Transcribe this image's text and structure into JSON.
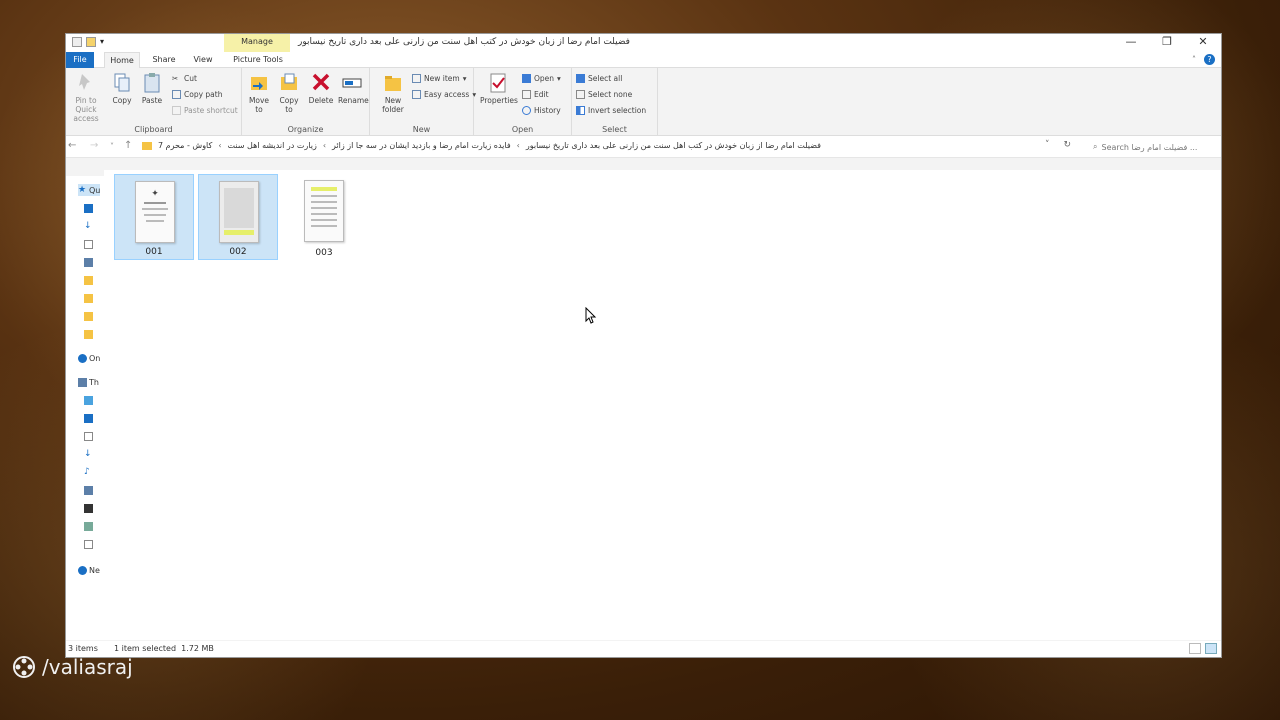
{
  "window": {
    "title": "فضیلت امام رضا از زبان خودش در کتب اهل سنت من زارنی علی بعد داری تاریخ نیسابور",
    "manage_tab": "Manage",
    "controls": {
      "minimize": "—",
      "maximize": "❐",
      "close": "✕"
    }
  },
  "tabs": {
    "file": "File",
    "home": "Home",
    "share": "Share",
    "view": "View",
    "picture_tools": "Picture Tools"
  },
  "ribbon": {
    "clipboard": {
      "label": "Clipboard",
      "pin": "Pin to Quick access",
      "copy": "Copy",
      "paste": "Paste",
      "cut": "Cut",
      "copy_path": "Copy path",
      "paste_shortcut": "Paste shortcut"
    },
    "organize": {
      "label": "Organize",
      "move_to": "Move to",
      "copy_to": "Copy to",
      "delete": "Delete",
      "rename": "Rename"
    },
    "new": {
      "label": "New",
      "new_folder": "New folder",
      "new_item": "New item",
      "easy_access": "Easy access"
    },
    "open": {
      "label": "Open",
      "properties": "Properties",
      "open": "Open",
      "edit": "Edit",
      "history": "History"
    },
    "select": {
      "label": "Select",
      "select_all": "Select all",
      "select_none": "Select none",
      "invert": "Invert selection"
    }
  },
  "address": {
    "crumbs": [
      "فضیلت امام رضا از زبان خودش در کتب اهل سنت من زارنی علی بعد داری تاریخ نیسابور",
      "فایده زیارت امام رضا و بازدید ایشان در سه جا از زائر",
      "زیارت در اندیشه اهل سنت",
      "کاوش - محرم 7"
    ],
    "search_placeholder": "Search فضیلت امام رضا ..."
  },
  "files": [
    {
      "name": "001"
    },
    {
      "name": "002"
    },
    {
      "name": "003"
    }
  ],
  "nav_pane": {
    "quick_access": "Qu",
    "onedrive": "On",
    "this_pc": "Th",
    "network": "Ne"
  },
  "status": {
    "count": "3 items",
    "selection": "1 item selected  1.72 MB"
  },
  "watermark": "/valiasraj",
  "colors": {
    "accent": "#1a6fc4",
    "manage": "#f6f1a8",
    "selection": "#cce4f7"
  }
}
